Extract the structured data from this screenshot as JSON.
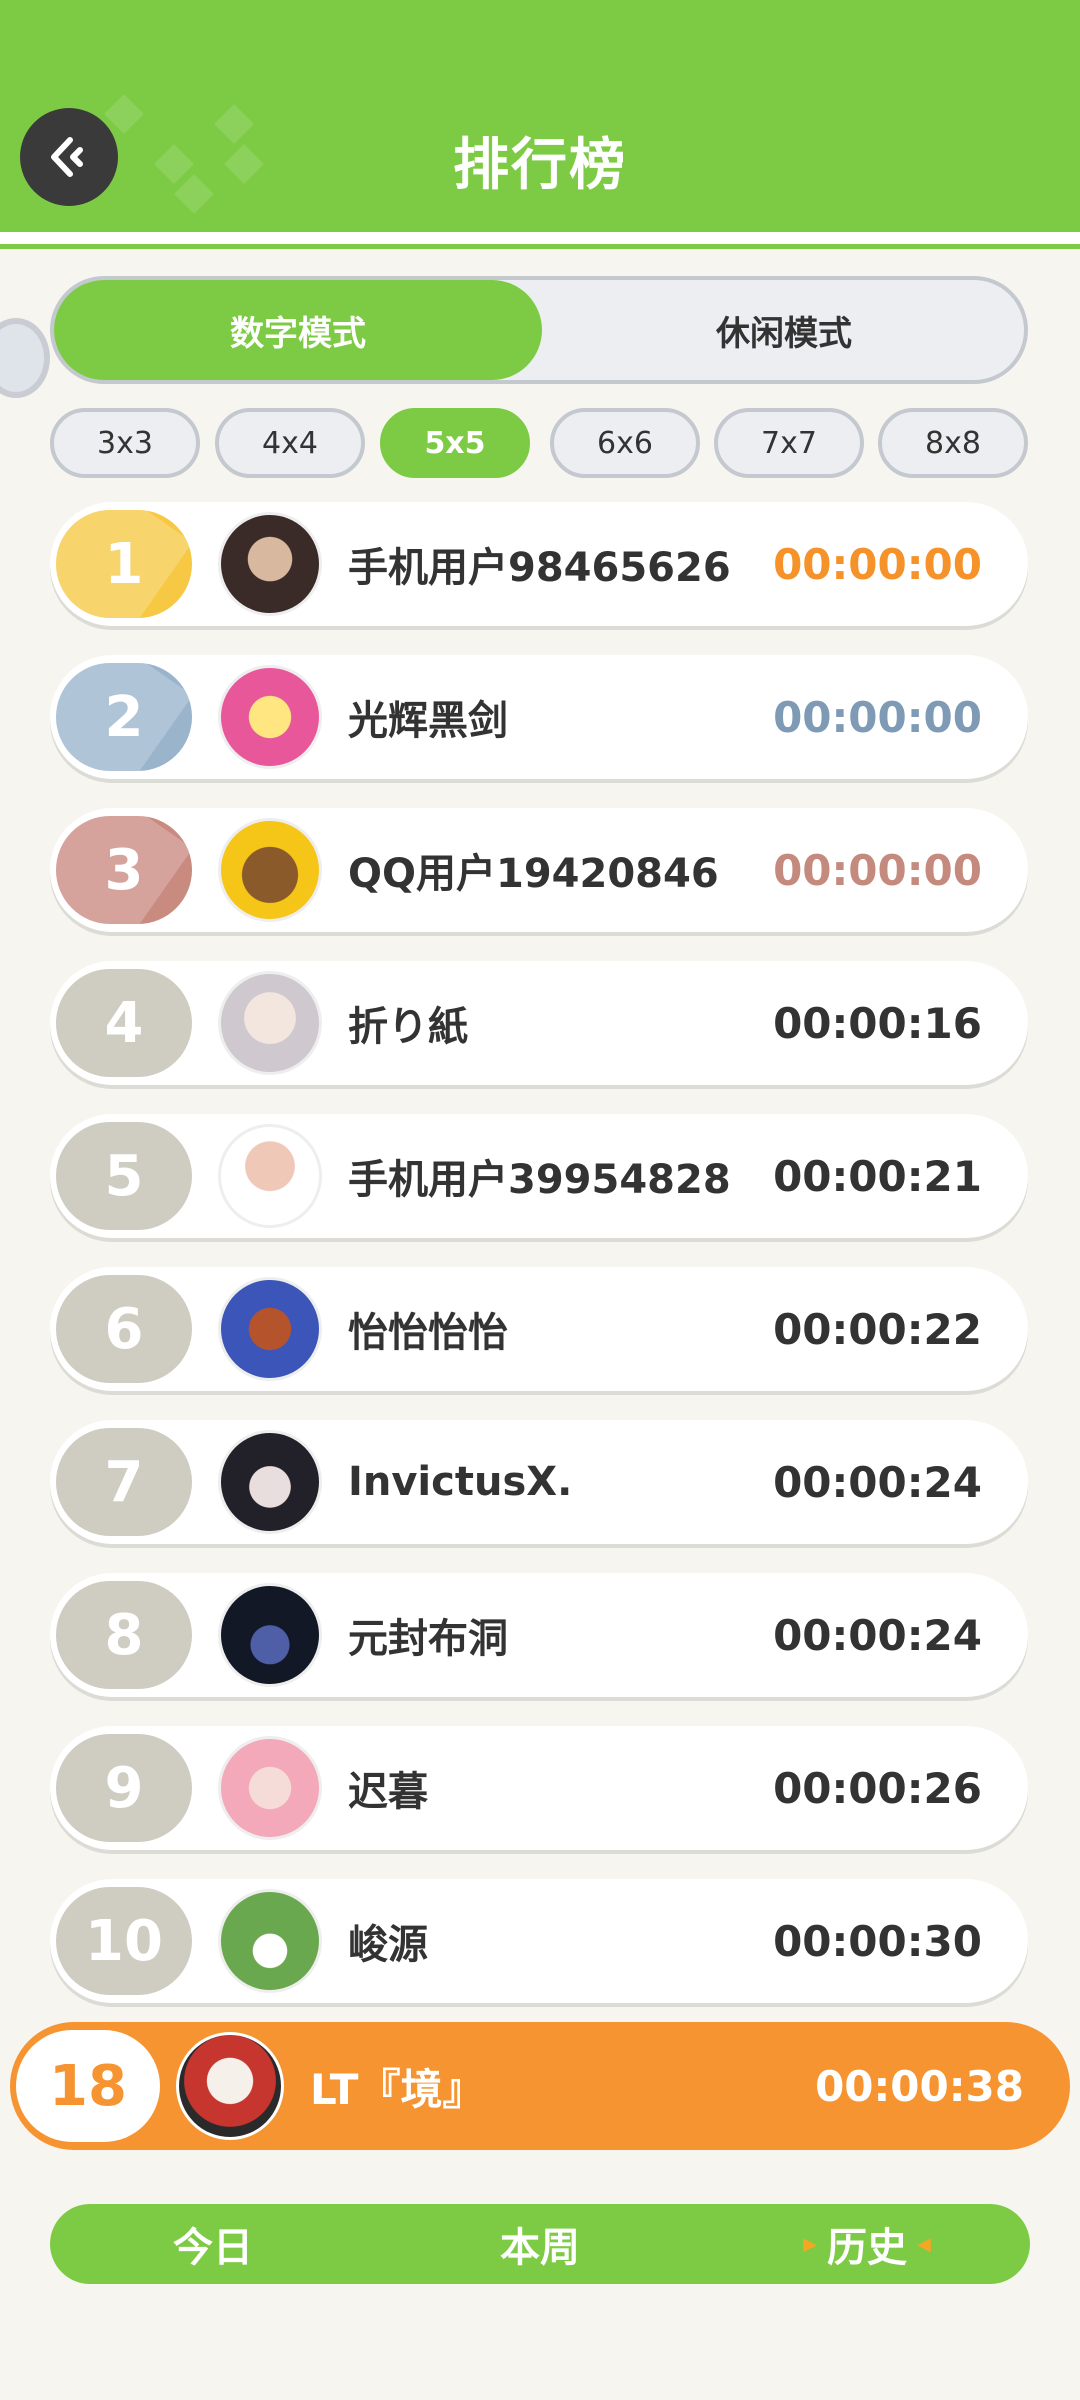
{
  "header": {
    "title": "排行榜"
  },
  "mode_tabs": [
    {
      "label": "数字模式",
      "active": true
    },
    {
      "label": "休闲模式",
      "active": false
    }
  ],
  "size_tabs": [
    {
      "label": "3x3",
      "active": false
    },
    {
      "label": "4x4",
      "active": false
    },
    {
      "label": "5x5",
      "active": true
    },
    {
      "label": "6x6",
      "active": false
    },
    {
      "label": "7x7",
      "active": false
    },
    {
      "label": "8x8",
      "active": false
    }
  ],
  "rankings": [
    {
      "rank": "1",
      "name": "手机用户98465626",
      "time": "00:00:00"
    },
    {
      "rank": "2",
      "name": "光辉黑剑",
      "time": "00:00:00"
    },
    {
      "rank": "3",
      "name": "QQ用户19420846",
      "time": "00:00:00"
    },
    {
      "rank": "4",
      "name": "折り紙",
      "time": "00:00:16"
    },
    {
      "rank": "5",
      "name": "手机用户39954828",
      "time": "00:00:21"
    },
    {
      "rank": "6",
      "name": "怡怡怡怡",
      "time": "00:00:22"
    },
    {
      "rank": "7",
      "name": "InvictusX.",
      "time": "00:00:24"
    },
    {
      "rank": "8",
      "name": "元封布洞",
      "time": "00:00:24"
    },
    {
      "rank": "9",
      "name": "迟暮",
      "time": "00:00:26"
    },
    {
      "rank": "10",
      "name": "峻源",
      "time": "00:00:30"
    }
  ],
  "my_rank": {
    "rank": "18",
    "name": "LT『境』",
    "time": "00:00:38"
  },
  "bottom_tabs": [
    {
      "label": "今日",
      "active": false
    },
    {
      "label": "本周",
      "active": false
    },
    {
      "label": "历史",
      "active": true
    }
  ],
  "colors": {
    "brand_green": "#7dcb45",
    "gold": "#f7c843",
    "silver": "#9ab4cc",
    "bronze": "#c98a80",
    "gray_badge": "#cfccc2",
    "orange": "#f59431",
    "gold_time": "#f5922a",
    "silver_time": "#7e9ab5",
    "bronze_time": "#c48a7d"
  }
}
